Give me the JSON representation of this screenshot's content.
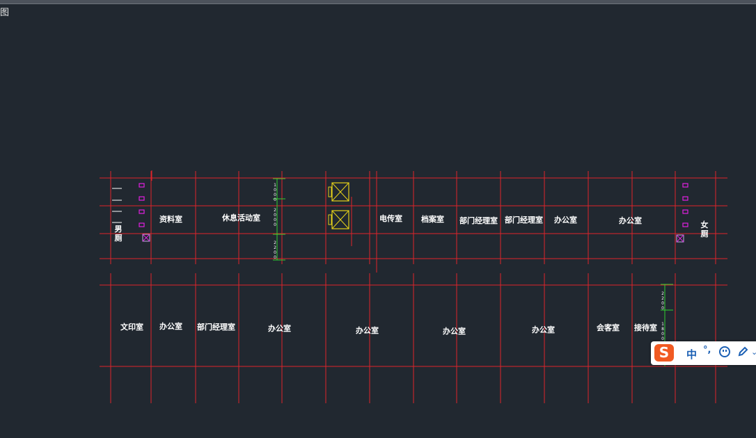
{
  "viewport": {
    "label": "图"
  },
  "rooms": {
    "upper": [
      "资料室",
      "休息活动室",
      "电传室",
      "档案室",
      "部门经理室",
      "部门经理室",
      "办公室",
      "办公室"
    ],
    "upper_vertical": {
      "mens_toilet": "男厕",
      "womens_toilet": "女厕"
    },
    "lower": [
      "文印室",
      "办公室",
      "部门经理室",
      "办公室",
      "办公室",
      "办公室",
      "办公室",
      "会客室",
      "接待室"
    ]
  },
  "dimensions": {
    "left": [
      "1000",
      "2000",
      "2200"
    ],
    "right": [
      "2200",
      "1800"
    ]
  },
  "ime_toolbar": {
    "logo": "S",
    "mode": "中",
    "punctuation": "°,"
  },
  "colors": {
    "background": "#212830",
    "grid_lines": "#e0232a",
    "dimension_lines": "#2fd12f",
    "elevator": "#e6d21a",
    "fixtures": "#e020e0"
  }
}
